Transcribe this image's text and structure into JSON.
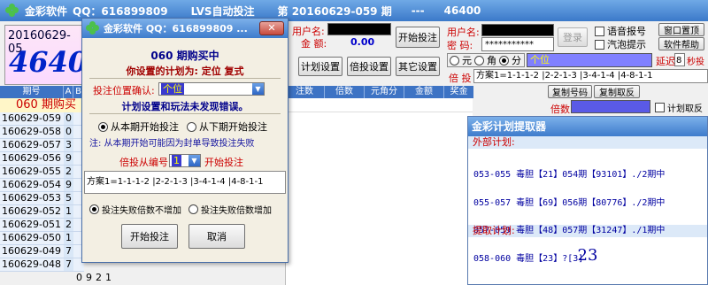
{
  "main_title": {
    "app": "金彩软件",
    "qq": "QQ：616899809",
    "mode": "LVS自动投注",
    "period_label": "第 20160629-059 期",
    "sep": "---",
    "number": "46400"
  },
  "left_panel": {
    "date": "20160629-05",
    "big_number": "4640"
  },
  "account": {
    "user_label": "用户名:",
    "password_label": "密  码:",
    "password_value": "***********",
    "login_button": "登录",
    "user_label2": "用户名:",
    "amount_label": "金  额:",
    "amount_value": "0.00",
    "start_button": "开始投注",
    "voice_label": "语音报号",
    "bubble_label": "汽泡提示",
    "window_top_button": "窗口置顶",
    "help_button": "软件帮助"
  },
  "toolbar": {
    "plan_settings": "计划设置",
    "multiplier_settings": "倍投设置",
    "other_settings": "其它设置"
  },
  "unit_options": {
    "yuan": "元",
    "jiao": "角",
    "fen": "分",
    "selected": "fen"
  },
  "position_select": "个位",
  "delay": {
    "label": "延迟",
    "value": "8",
    "unit": "秒投注"
  },
  "multiplier_label": "倍 投",
  "scheme_line": "方案1=1-1-1-2 |2-2-1-3 |3-4-1-4 |4-8-1-1",
  "copy_buttons": {
    "copy_number": "复制号码",
    "copy_reverse": "复制取反"
  },
  "multiplier_row": {
    "label": "倍数",
    "plan_reverse": "计划取反"
  },
  "table_header": [
    "期号",
    "A",
    "B",
    "注数",
    "倍数",
    "元角分",
    "金额",
    "奖金"
  ],
  "banner_060": "060 期购买",
  "periods": [
    {
      "p": "160629-059",
      "d": "0"
    },
    {
      "p": "160629-058",
      "d": "0"
    },
    {
      "p": "160629-057",
      "d": "3"
    },
    {
      "p": "160629-056",
      "d": "9"
    },
    {
      "p": "160629-055",
      "d": "2"
    },
    {
      "p": "160629-054",
      "d": "9"
    },
    {
      "p": "160629-053",
      "d": "5"
    },
    {
      "p": "160629-052",
      "d": "1"
    },
    {
      "p": "160629-051",
      "d": "2"
    },
    {
      "p": "160629-050",
      "d": "1"
    },
    {
      "p": "160629-049",
      "d": "7"
    },
    {
      "p": "160629-048",
      "d": "7"
    }
  ],
  "last_row_digits": [
    "0",
    "9",
    "2",
    "1"
  ],
  "extractor": {
    "title": "金彩计划提取器",
    "external_label": "外部计划:",
    "plan_lines": [
      "053-055 毒胆【21】054期【93101】./2期中",
      "055-057 毒胆【69】056期【80776】./2期中",
      "057-059 毒胆【48】057期【31247】./1期中",
      "058-060 毒胆【23】?[3]"
    ],
    "extract_label": "提取计划:",
    "result": "23"
  },
  "dialog": {
    "title": "金彩软件 QQ：616899809 ...",
    "close_icon": "✕",
    "period_title": "060  期购买中",
    "plan_set_as": "你设置的计划为: 定位 复式",
    "position_confirm_label": "投注位置确认:",
    "position_value": "个位",
    "status_ok": "计划设置和玩法未发现错误。",
    "start_this": "从本期开始投注",
    "start_next": "从下期开始投注",
    "note": "注: 从本期开始可能因为封单导致投注失败",
    "start_from_label": "倍投从编号",
    "start_from_value": "1",
    "start_from_suffix": "开始投注",
    "scheme": "方案1=1-1-1-2 |2-2-1-3 |3-4-1-4 |4-8-1-1",
    "fail_no_increase": "投注失败倍数不增加",
    "fail_increase": "投注失败倍数增加",
    "start_button": "开始投注",
    "cancel_button": "取消"
  }
}
